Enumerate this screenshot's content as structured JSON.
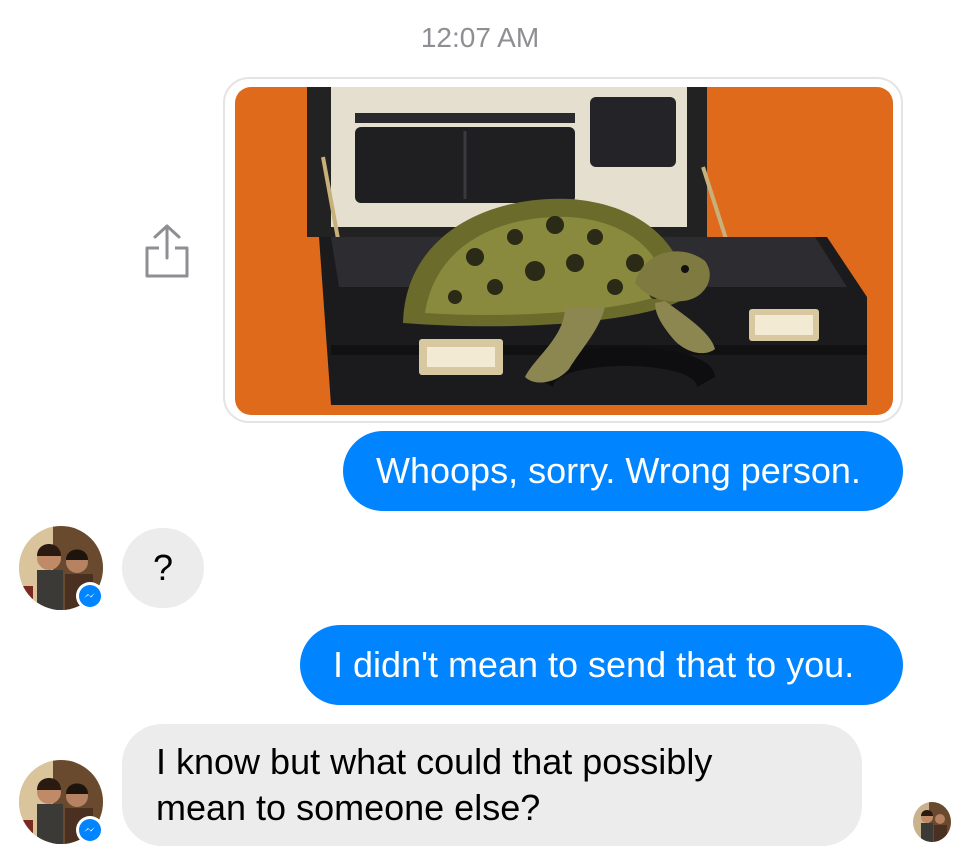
{
  "conversation": {
    "timestamp": "12:07 AM",
    "messages": [
      {
        "from": "me",
        "type": "image",
        "image": "turtle-in-open-briefcase"
      },
      {
        "from": "me",
        "type": "text",
        "text": "Whoops, sorry. Wrong person."
      },
      {
        "from": "them",
        "type": "text",
        "text": "?"
      },
      {
        "from": "me",
        "type": "text",
        "text": "I didn't mean to send that to you."
      },
      {
        "from": "them",
        "type": "text",
        "text": "I know but what could that possibly\nmean to someone else?"
      }
    ]
  },
  "icons": {
    "share": "share-icon",
    "messenger_badge": "messenger-badge-icon",
    "seen_receipt": "seen-avatar"
  },
  "colors": {
    "outgoing_bubble": "#0084ff",
    "incoming_bubble": "#ececec",
    "timestamp_text": "#8e8e93",
    "photo_background": "#e06a1b"
  }
}
